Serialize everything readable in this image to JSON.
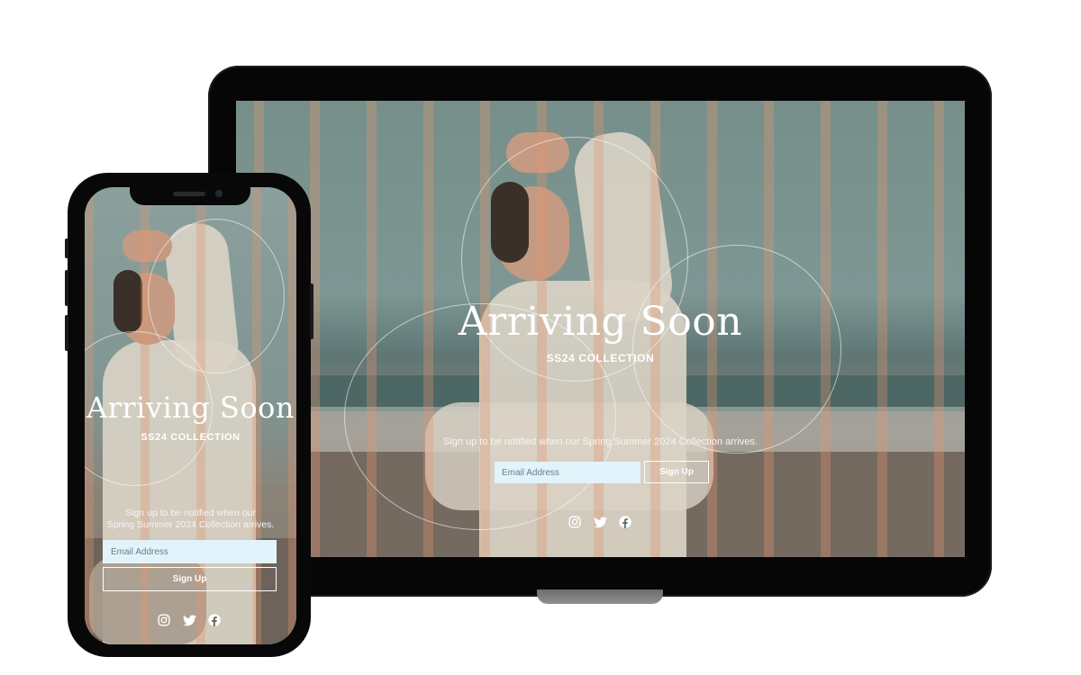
{
  "hero": {
    "title": "Arriving Soon",
    "subtitle": "SS24 COLLECTION",
    "description": "Sign up to be notified when our Spring Summer 2024 Collection arrives.",
    "mobile_description_line1": "Sign up to be notified when our",
    "mobile_description_line2": "Spring Summer 2024 Collection arrives.",
    "email_placeholder": "Email Address",
    "signup_label": "Sign Up"
  },
  "social": [
    "instagram-icon",
    "twitter-icon",
    "facebook-icon"
  ],
  "colors": {
    "input_bg": "#e3f3fb",
    "stripe": "#e2966e",
    "device": "#080808"
  }
}
